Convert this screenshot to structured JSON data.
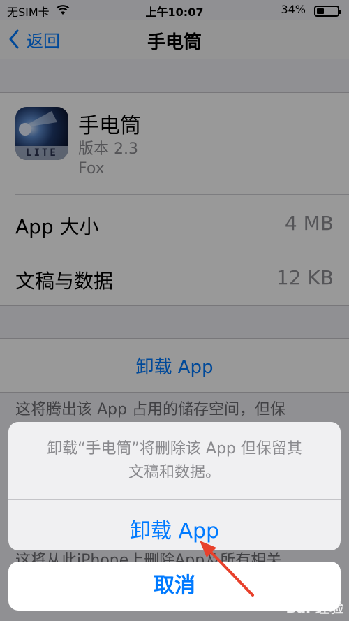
{
  "status_bar": {
    "carrier": "无SIM卡",
    "wifi_icon": "wifi-icon",
    "time": "上午10:07",
    "battery_text": "34%",
    "battery_level": 0.34
  },
  "nav": {
    "back_label": "返回",
    "back_icon": "chevron-left-icon",
    "title": "手电筒"
  },
  "app": {
    "name": "手电筒",
    "version": "版本 2.3",
    "developer": "Fox",
    "icon_badge": "LITE"
  },
  "storage": [
    {
      "label": "App 大小",
      "value": "4 MB"
    },
    {
      "label": "文稿与数据",
      "value": "12 KB"
    }
  ],
  "offload": {
    "button_label": "卸载 App",
    "footnote": "这将腾出该 App 占用的储存空间，但保"
  },
  "delete_footnote_partial": "这将从此iPhone上删除App及所有相关",
  "action_sheet": {
    "message_line1": "卸载“手电筒”将删除该 App 但保留其",
    "message_line2": "文稿和数据。",
    "confirm_label": "卸载 App",
    "cancel_label": "取消"
  },
  "colors": {
    "accent": "#007aff",
    "annotation_arrow": "#e8412c"
  },
  "watermark": "Bai 经验"
}
